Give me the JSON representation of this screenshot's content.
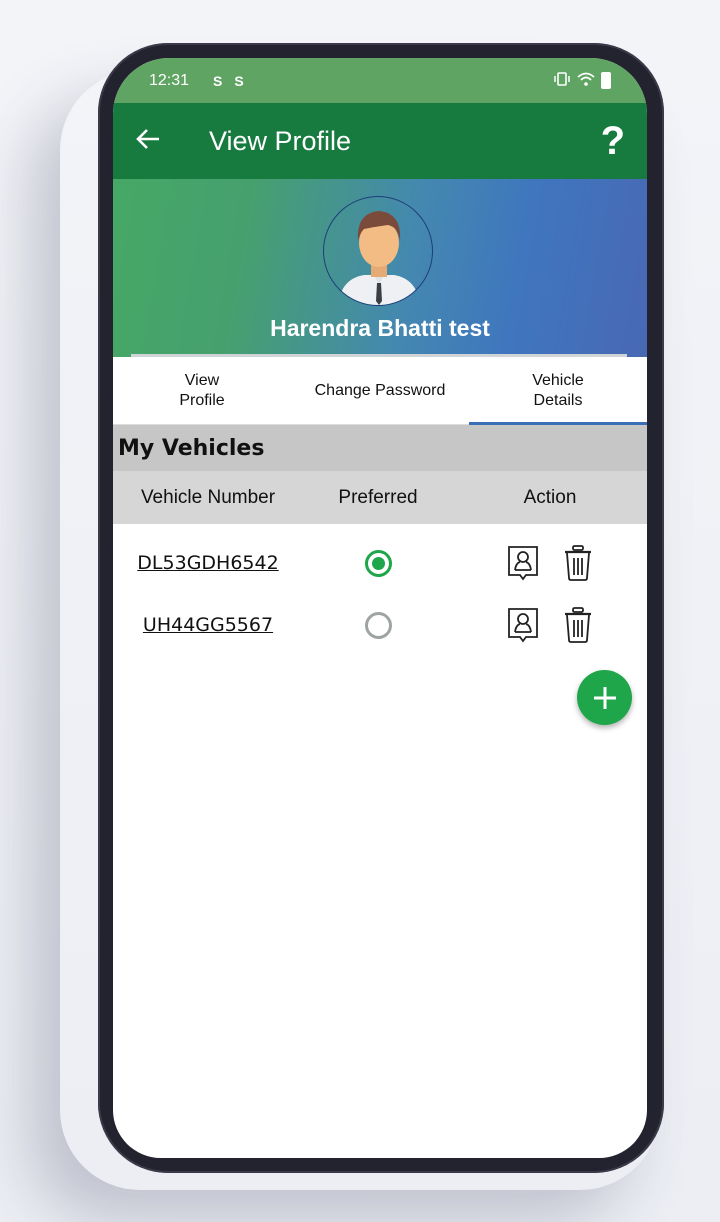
{
  "status_bar": {
    "time": "12:31",
    "left_icons": [
      "notification-s-icon",
      "notification-s-icon"
    ],
    "right_icons": [
      "vibrate-icon",
      "wifi-icon",
      "battery-charging-icon"
    ]
  },
  "app_bar": {
    "back_icon": "arrow-left-icon",
    "title": "View Profile",
    "help_label": "?"
  },
  "profile": {
    "name": "Harendra Bhatti test"
  },
  "tabs": [
    {
      "label": "View\nProfile",
      "active": false
    },
    {
      "label": "Change Password",
      "active": false
    },
    {
      "label": "Vehicle\nDetails",
      "active": true
    }
  ],
  "vehicles": {
    "section_title": "My Vehicles",
    "columns": [
      "Vehicle Number",
      "Preferred",
      "Action"
    ],
    "rows": [
      {
        "number": "DL53GDH6542",
        "preferred": true
      },
      {
        "number": "UH44GG5567",
        "preferred": false
      }
    ],
    "add_icon": "plus-icon"
  },
  "colors": {
    "status_bar": "#5fa463",
    "app_bar": "#177a3f",
    "accent_green": "#1fa64a",
    "tab_indicator": "#3a6fb8"
  }
}
